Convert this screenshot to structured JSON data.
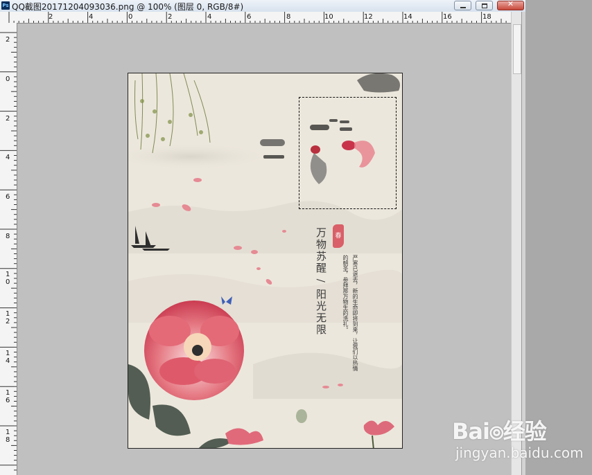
{
  "window": {
    "title": "QQ截图20171204093036.png @ 100% (图层 0, RGB/8#)",
    "app_icon_label": "Ps",
    "buttons": {
      "minimize_icon": "minimize-icon",
      "maximize_icon": "maximize-icon",
      "close_icon": "close-icon",
      "close_label": "✕"
    }
  },
  "rulers": {
    "top_labels": [
      "2",
      "4",
      "2",
      "0",
      "2",
      "4",
      "6",
      "8",
      "10",
      "12",
      "14",
      "16",
      "18"
    ],
    "left_labels": [
      "2",
      "0",
      "2",
      "4",
      "6",
      "8",
      "1\n0",
      "1\n2",
      "1\n4",
      "1\n6",
      "1\n8"
    ]
  },
  "document": {
    "title_vertical": "万物苏醒 / 阳光无限",
    "seal_text": "春",
    "body_lines": [
      "严寒已退去，新的生命即将到来，让我们以热情",
      "的朝圣，参拜那万物生的洗礼。",
      ""
    ],
    "selection_visible": true
  },
  "watermark": {
    "logo": "Bai 百 经验",
    "url": "jingyan.baidu.com"
  },
  "colors": {
    "canvas_bg": "#c0c0c0",
    "paper": "#ece7dc",
    "peony": "#d9525d",
    "ink": "#3a3a3a"
  }
}
